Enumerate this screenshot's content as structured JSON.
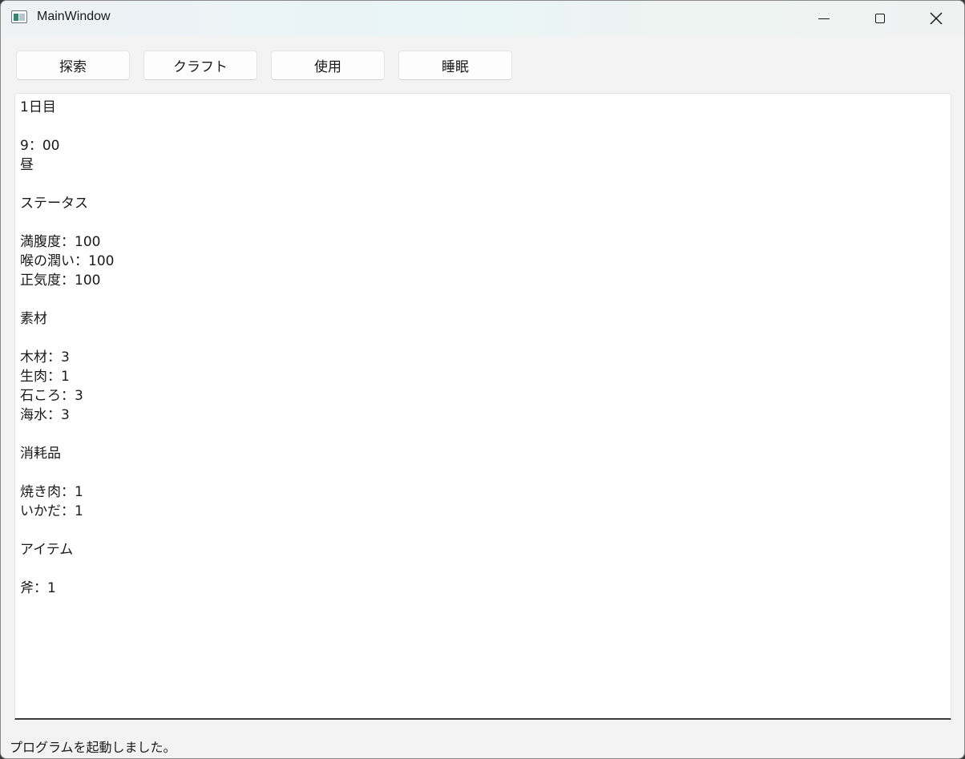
{
  "window": {
    "title": "MainWindow"
  },
  "toolbar": {
    "explore_label": "探索",
    "craft_label": "クラフト",
    "use_label": "使用",
    "sleep_label": "睡眠"
  },
  "log": {
    "lines": [
      "1日目",
      "",
      "9：00",
      "昼",
      "",
      "ステータス",
      "",
      "満腹度：100",
      "喉の潤い：100",
      "正気度：100",
      "",
      "素材",
      "",
      "木材：3",
      "生肉：1",
      "石ころ：3",
      "海水：3",
      "",
      "消耗品",
      "",
      "焼き肉：1",
      "いかだ：1",
      "",
      "アイテム",
      "",
      "斧：1"
    ]
  },
  "status": {
    "message": "プログラムを起動しました。"
  },
  "icons": {
    "app": "app-window-icon",
    "minimize": "minimize-icon",
    "maximize": "maximize-icon",
    "close": "close-icon"
  }
}
